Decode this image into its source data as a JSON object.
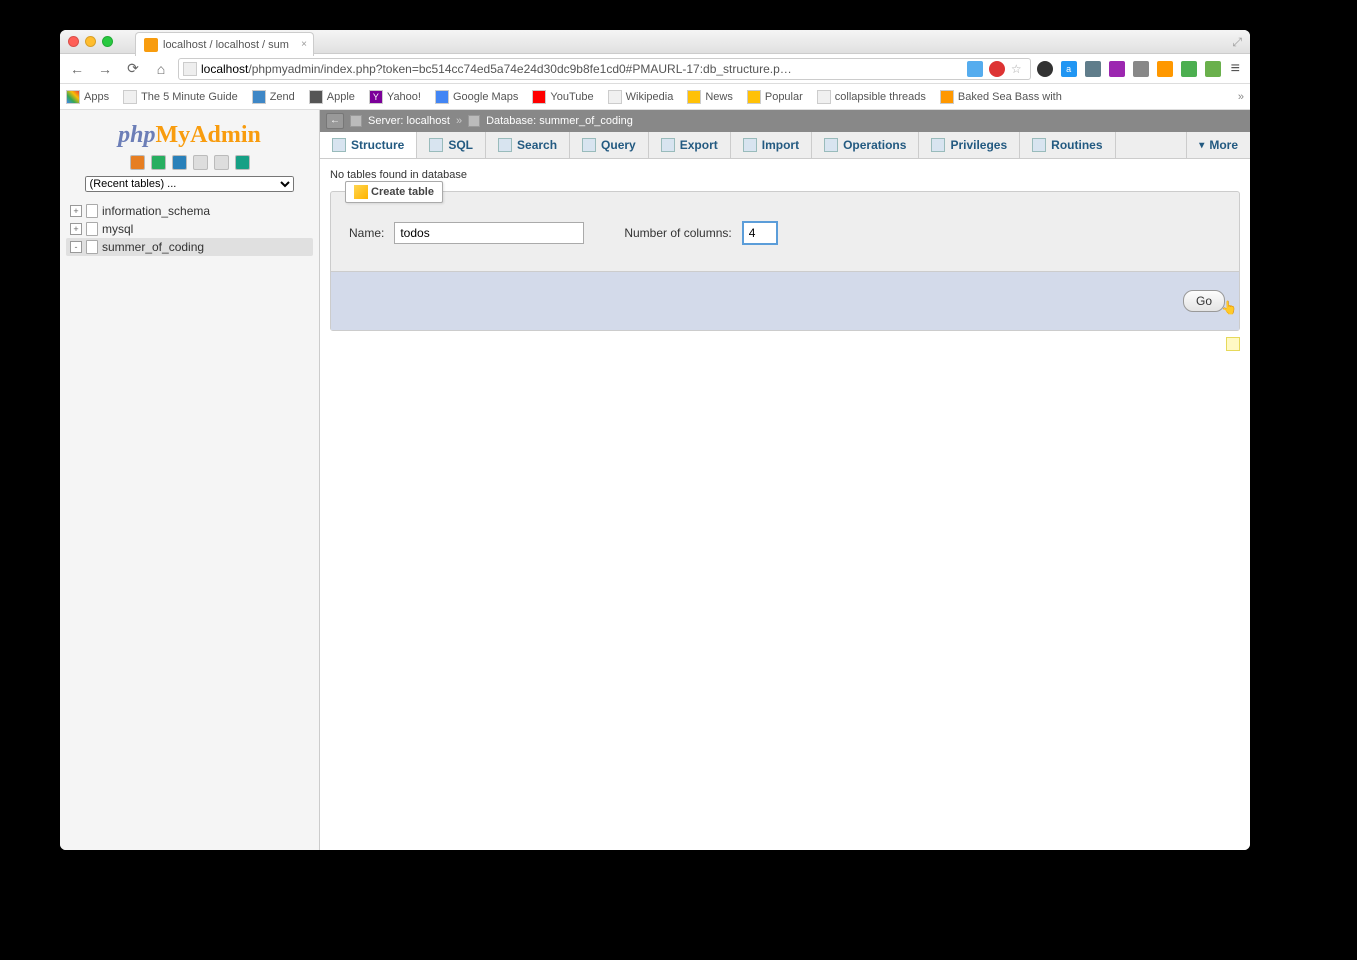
{
  "browser": {
    "tab_title": "localhost / localhost / sum",
    "url_host": "localhost",
    "url_path": "/phpmyadmin/index.php?token=bc514cc74ed5a74e24d30dc9b8fe1cd0#PMAURL-17:db_structure.p…"
  },
  "bookmarks": [
    {
      "label": "Apps"
    },
    {
      "label": "The 5 Minute Guide"
    },
    {
      "label": "Zend"
    },
    {
      "label": "Apple"
    },
    {
      "label": "Yahoo!"
    },
    {
      "label": "Google Maps"
    },
    {
      "label": "YouTube"
    },
    {
      "label": "Wikipedia"
    },
    {
      "label": "News"
    },
    {
      "label": "Popular"
    },
    {
      "label": "collapsible threads"
    },
    {
      "label": "Baked Sea Bass with"
    }
  ],
  "sidebar": {
    "logo_php": "php",
    "logo_my": "My",
    "logo_admin": "Admin",
    "recent_label": "(Recent tables) ...",
    "tree": [
      {
        "name": "information_schema",
        "expand": "+",
        "selected": false
      },
      {
        "name": "mysql",
        "expand": "+",
        "selected": false
      },
      {
        "name": "summer_of_coding",
        "expand": "-",
        "selected": true
      }
    ]
  },
  "breadcrumb": {
    "server_label": "Server: localhost",
    "db_label": "Database: summer_of_coding"
  },
  "tabs": [
    "Structure",
    "SQL",
    "Search",
    "Query",
    "Export",
    "Import",
    "Operations",
    "Privileges",
    "Routines",
    "More"
  ],
  "active_tab": "Structure",
  "status": "No tables found in database",
  "create_panel": {
    "title": "Create table",
    "name_label": "Name:",
    "name_value": "todos",
    "cols_label": "Number of columns:",
    "cols_value": "4",
    "go_label": "Go"
  }
}
